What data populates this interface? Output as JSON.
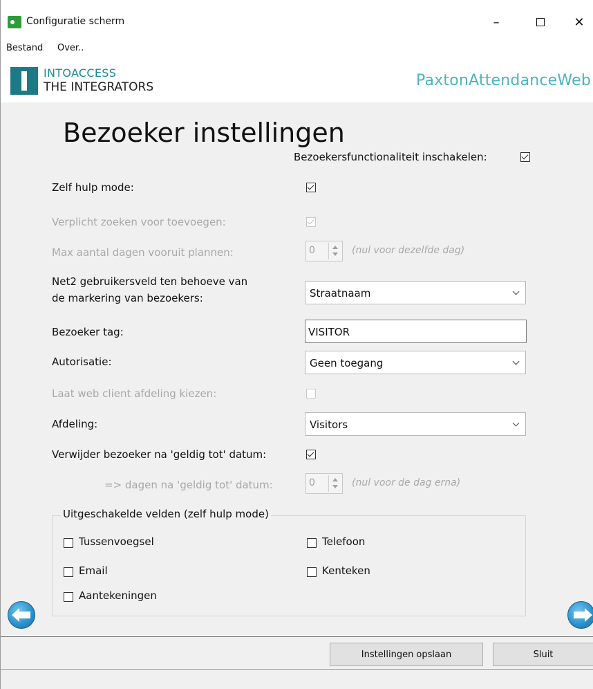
{
  "window": {
    "title": "Configuratie scherm",
    "minimize": "–",
    "close": "✕"
  },
  "menu": [
    "Bestand",
    "Over.."
  ],
  "header": {
    "logo_line1": "INTOACCESS",
    "logo_line2": "THE INTEGRATORS",
    "brand": "PaxtonAttendanceWeb"
  },
  "page": {
    "title": "Bezoeker instellingen",
    "enable_label": "Bezoekersfunctionaliteit inschakelen:",
    "enable_checked": true
  },
  "settings": {
    "self_help_label": "Zelf hulp mode:",
    "required_search_label": "Verplicht zoeken voor toevoegen:",
    "max_days_label": "Max aantal dagen vooruit plannen:",
    "max_days_value": "0",
    "max_days_hint": "(nul voor dezelfde dag)",
    "net2_field_label_1": "Net2 gebruikersveld ten behoeve van",
    "net2_field_label_2": "de markering van bezoekers:",
    "net2_field_value": "Straatnaam",
    "visitor_tag_label": "Bezoeker tag:",
    "visitor_tag_value": "VISITOR",
    "authorization_label": "Autorisatie:",
    "authorization_value": "Geen toegang",
    "web_client_dept_label": "Laat web client afdeling kiezen:",
    "department_label": "Afdeling:",
    "department_value": "Visitors",
    "delete_after_label": "Verwijder bezoeker na 'geldig tot' datum:",
    "days_after_label": "=> dagen na 'geldig tot' datum:",
    "days_after_value": "0",
    "days_after_hint": "(nul voor de dag erna)"
  },
  "disabled_fields": {
    "legend": "Uitgeschakelde velden (zelf hulp mode)",
    "options": [
      "Tussenvoegsel",
      "Telefoon",
      "Email",
      "Kenteken",
      "Aantekeningen"
    ]
  },
  "buttons": {
    "save": "Instellingen opslaan",
    "close": "Sluit"
  },
  "colors": {
    "brand_teal": "#4ab4c0",
    "logo_teal": "#1b7a86",
    "nav_arrow_blue": "#2a8fc9"
  }
}
